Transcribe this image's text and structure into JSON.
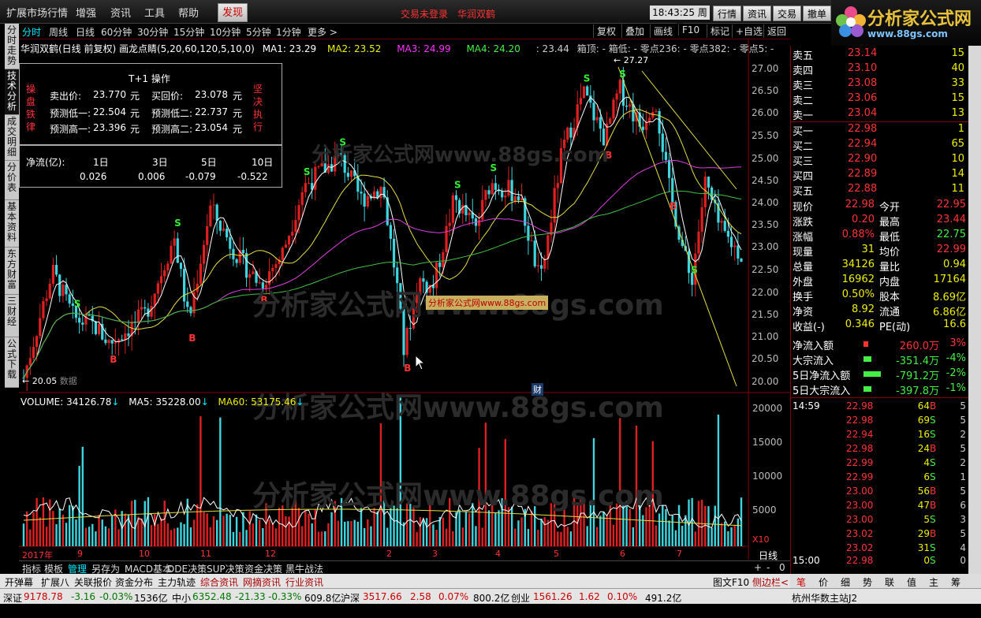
{
  "menubar": {
    "items": [
      "扩展市场行情",
      "增强",
      "资讯",
      "工具",
      "帮助"
    ],
    "faxian": "发现",
    "not_logged": "交易未登录",
    "stock_name": "华润双鹤",
    "time": "18:43:25",
    "weekday": "周二",
    "buttons": [
      "行情",
      "资讯",
      "交易",
      "撤单"
    ]
  },
  "logo": {
    "title": "分析家公式网",
    "url": "www.88gs.com"
  },
  "periods": [
    "分时",
    "周线",
    "日线",
    "60分钟",
    "30分钟",
    "15分钟",
    "10分钟",
    "5分钟",
    "1分钟",
    "更多 >"
  ],
  "right_buttons": [
    "复权",
    "叠加",
    "画线",
    "F10",
    "标记",
    "+自选",
    "返回"
  ],
  "left_tabs": [
    "分时走势",
    "技术分析",
    "成交明细",
    "分价表",
    "基本资料",
    "东方财富",
    "三财经",
    "公式下载"
  ],
  "info": {
    "title": "华润双鹤(日线 前复权) 画龙点睛(5,20,60,120,5,10,0)",
    "ma1": "MA1: 23.29",
    "ma2": "MA2: 23.52",
    "ma3": "MA3: 24.99",
    "ma4": "MA4: 24.20",
    "extra": ": 23.44",
    "box": "箱顶: - 箱低: - 零点236: - 零点382: - 零点5: -"
  },
  "tplus": {
    "title": "T+1 操作",
    "left": "操盘铁律",
    "right": "坚决执行",
    "sell_label": "卖出价:",
    "sell": "23.770",
    "buy_label": "买回价:",
    "buy": "23.078",
    "low1_label": "预测低一:",
    "low1": "22.504",
    "low2_label": "预测低二:",
    "low2": "22.737",
    "high1_label": "预测高一:",
    "high1": "23.396",
    "high2_label": "预测高二:",
    "high2": "23.054",
    "unit": "元"
  },
  "flow": {
    "label": "净流(亿):",
    "periods": [
      "1日",
      "3日",
      "5日",
      "10日"
    ],
    "values": [
      "0.026",
      "0.006",
      "-0.079",
      "-0.522"
    ]
  },
  "chart_labels": {
    "high_mark": "27.27",
    "low_mark": "20.05",
    "low_note": "数据",
    "watermark": "分析家公式网www.88gs.com",
    "watermark2": "分析家公式网www.88gs.com",
    "cai": "财"
  },
  "yaxis": [
    "27.00",
    "26.50",
    "26.00",
    "25.50",
    "25.00",
    "24.50",
    "24.00",
    "23.50",
    "23.00",
    "22.50",
    "22.00",
    "21.50",
    "21.00",
    "20.50",
    "20.00"
  ],
  "volume": {
    "v": "VOLUME: 34126.78",
    "ma5": "MA5: 35228.00",
    "ma60": "MA60: 53175.46",
    "yaxis": [
      "20000",
      "15000",
      "10000",
      "5000"
    ],
    "x10": "X10"
  },
  "xaxis": [
    "2017年",
    "9",
    "10",
    "11",
    "12",
    "2",
    "3",
    "4",
    "5",
    "6",
    "7"
  ],
  "day_label": "日线",
  "bottom_tools": [
    "指标",
    "模板",
    "管理",
    "另存为",
    "MACD基本",
    "DDE决策",
    "SUP决策",
    "资金决策",
    "黑牛战法"
  ],
  "news": [
    "开弹幕",
    "扩展八",
    "关联报价",
    "资金分布",
    "主力轨迹",
    "综合资讯",
    "网摘资讯",
    "行业资讯"
  ],
  "news_right": [
    "图文F10",
    "侧边栏<"
  ],
  "status": {
    "sz_label": "深证",
    "sz": "9178.78",
    "sz_chg": "-3.16",
    "sz_pct": "-0.03%",
    "sz_amt": "1536亿",
    "zx_label": "中小",
    "zx": "6352.48",
    "zx_chg": "-21.33",
    "zx_pct": "-0.33%",
    "zx_amt": "609.8亿",
    "hs_label": "沪深",
    "hs": "3517.66",
    "hs_chg": "2.58",
    "hs_pct": "0.07%",
    "hs_amt": "800.2亿",
    "cy_label": "创业",
    "cy": "1561.26",
    "cy_chg": "1.62",
    "cy_pct": "0.10%",
    "cy_amt": "491.2亿",
    "server": "杭州华数主站J2"
  },
  "orderbook": [
    {
      "l": "卖五",
      "p": "23.14",
      "v": "15"
    },
    {
      "l": "卖四",
      "p": "23.10",
      "v": "40"
    },
    {
      "l": "卖三",
      "p": "23.08",
      "v": "33"
    },
    {
      "l": "卖二",
      "p": "23.06",
      "v": "15"
    },
    {
      "l": "卖一",
      "p": "23.04",
      "v": "13"
    },
    {
      "l": "买一",
      "p": "22.98",
      "v": "1"
    },
    {
      "l": "买二",
      "p": "22.94",
      "v": "65"
    },
    {
      "l": "买三",
      "p": "22.90",
      "v": "10"
    },
    {
      "l": "买四",
      "p": "22.89",
      "v": "14"
    },
    {
      "l": "买五",
      "p": "22.88",
      "v": "11"
    }
  ],
  "quotes": [
    {
      "a": "现价",
      "av": "22.98",
      "b": "今开",
      "bv": "22.95"
    },
    {
      "a": "涨跌",
      "av": "0.20",
      "b": "最高",
      "bv": "23.44"
    },
    {
      "a": "涨幅",
      "av": "0.88%",
      "b": "最低",
      "bv": "22.75"
    },
    {
      "a": "现量",
      "av": "31",
      "b": "均价",
      "bv": "22.99"
    },
    {
      "a": "总量",
      "av": "34126",
      "b": "量比",
      "bv": "0.94"
    },
    {
      "a": "外盘",
      "av": "16962",
      "b": "内盘",
      "bv": "17164"
    },
    {
      "a": "换手",
      "av": "0.50%",
      "b": "股本",
      "bv": "8.69亿"
    },
    {
      "a": "净资",
      "av": "8.92",
      "b": "流通",
      "bv": "6.86亿"
    },
    {
      "a": "收益(-)",
      "av": "0.346",
      "b": "PE(动)",
      "bv": "16.6"
    }
  ],
  "fund": [
    {
      "l": "净流入额",
      "v": "260.0万",
      "p": "3%"
    },
    {
      "l": "大宗流入",
      "v": "-351.4万",
      "p": "-4%"
    },
    {
      "l": "5日净流入额",
      "v": "-791.2万",
      "p": "-2%"
    },
    {
      "l": "5日大宗流入",
      "v": "-397.8万",
      "p": "-1%"
    }
  ],
  "ticks": [
    {
      "t": "14:59",
      "p": "22.98",
      "v": "64",
      "bs": "B",
      "n": "5"
    },
    {
      "t": "",
      "p": "22.98",
      "v": "69",
      "bs": "S",
      "n": "5"
    },
    {
      "t": "",
      "p": "22.94",
      "v": "16",
      "bs": "S",
      "n": "2"
    },
    {
      "t": "",
      "p": "22.98",
      "v": "24",
      "bs": "B",
      "n": "5"
    },
    {
      "t": "",
      "p": "22.99",
      "v": "4",
      "bs": "S",
      "n": "2"
    },
    {
      "t": "",
      "p": "22.99",
      "v": "6",
      "bs": "S",
      "n": "1"
    },
    {
      "t": "",
      "p": "23.00",
      "v": "56",
      "bs": "B",
      "n": "5"
    },
    {
      "t": "",
      "p": "23.00",
      "v": "47",
      "bs": "B",
      "n": "6"
    },
    {
      "t": "",
      "p": "23.00",
      "v": "5",
      "bs": "S",
      "n": "3"
    },
    {
      "t": "",
      "p": "23.02",
      "v": "29",
      "bs": "B",
      "n": "5"
    },
    {
      "t": "",
      "p": "23.02",
      "v": "31",
      "bs": "S",
      "n": "4"
    },
    {
      "t": "15:00",
      "p": "22.98",
      "v": "0",
      "bs": "S",
      "n": "0"
    }
  ],
  "right_tabs": [
    "笔",
    "价",
    "细",
    "势",
    "联",
    "值",
    "主",
    "筹"
  ]
}
